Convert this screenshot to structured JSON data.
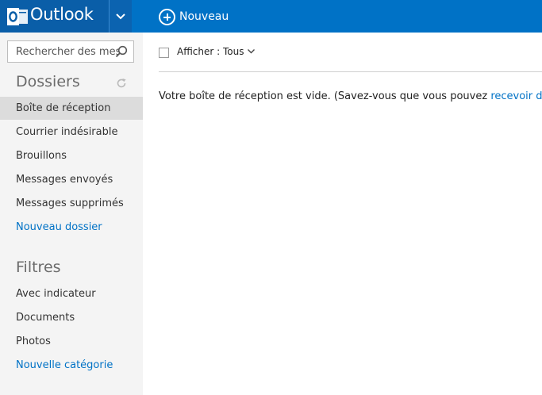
{
  "header": {
    "brand": "Outlook",
    "new_label": "Nouveau"
  },
  "sidebar": {
    "search_placeholder": "Rechercher des mes",
    "folders_title": "Dossiers",
    "folders": [
      {
        "label": "Boîte de réception"
      },
      {
        "label": "Courrier indésirable"
      },
      {
        "label": "Brouillons"
      },
      {
        "label": "Messages envoyés"
      },
      {
        "label": "Messages supprimés"
      }
    ],
    "new_folder": "Nouveau dossier",
    "filters_title": "Filtres",
    "filters": [
      {
        "label": "Avec indicateur"
      },
      {
        "label": "Documents"
      },
      {
        "label": "Photos"
      }
    ],
    "new_category": "Nouvelle catégorie"
  },
  "main": {
    "filter_label": "Afficher : Tous",
    "empty_text": "Votre boîte de réception est vide. (Savez-vous que vous pouvez ",
    "empty_link": "recevoir des m"
  },
  "colors": {
    "accent": "#0072c6",
    "brand_dark": "#0a5ea8",
    "sidebar_bg": "#f4f4f4",
    "selected_bg": "#dcdcdc"
  },
  "icons": [
    "outlook-logo-icon",
    "chevron-down-icon",
    "plus-circle-icon",
    "search-icon",
    "refresh-icon"
  ]
}
